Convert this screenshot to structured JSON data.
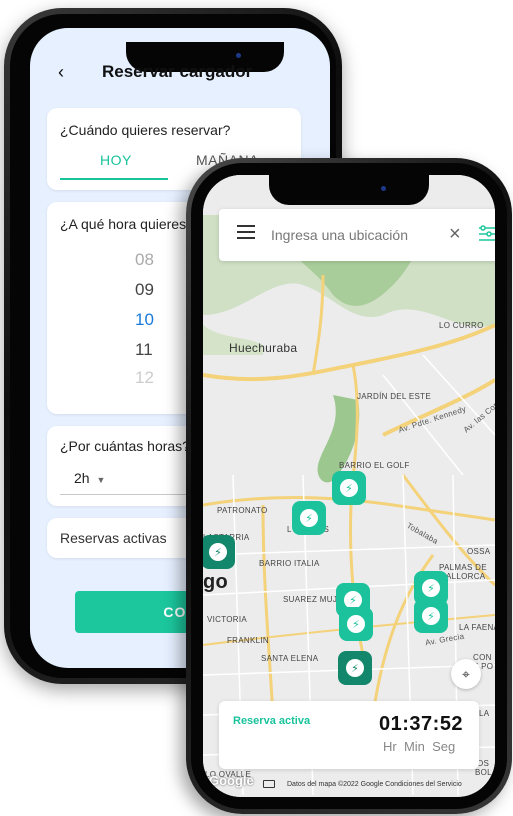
{
  "booking": {
    "title": "Reservar cargador",
    "when_question": "¿Cuándo quieres reservar?",
    "tabs": [
      {
        "label": "HOY"
      },
      {
        "label": "MAÑANA"
      }
    ],
    "hour_question": "¿A qué hora quieres",
    "hours": [
      "08",
      "09",
      "10",
      "11",
      "12"
    ],
    "selected_hour": "10",
    "duration_question": "¿Por cuántas horas?",
    "duration_value": "2h",
    "active_reservations": "Reservas activas",
    "cta_label": "CONTIN"
  },
  "map": {
    "search_placeholder": "Ingresa una ubicación",
    "labels": {
      "huechuraba": "Huechuraba",
      "lo_curro": "LO CURRO",
      "jardin": "JARDÍN DEL ESTE",
      "av_kennedy": "Av. Pdte. Kennedy",
      "av_condes": "Av. las Cond",
      "barrio_golf": "BARRIO EL GOLF",
      "patronato": "PATRONATO",
      "lastarria": "LASTARRIA",
      "bosques": "L   ANQUES",
      "tobalaba": "Tobalaba",
      "barrio_italia": "BARRIO ITALIA",
      "ossa": "OSSA",
      "palmas": "PALMAS DE",
      "mallorca": "MALLORCA",
      "go": "go",
      "suarez": "SUAREZ MUJ",
      "victoria": "VICTORIA",
      "la_faena": "LA FAENA",
      "av_grecia": "Av. Grecia",
      "franklin": "FRANKLIN",
      "santa_elena": "SANTA ELENA",
      "con": "CON",
      "e_po": "E PO",
      "la": "LA",
      "lo_ovalle": "LO OVALLE",
      "os": "OS",
      "bol": "BOL"
    },
    "active_reservation_label": "Reserva activa",
    "timer": "01:37:52",
    "timer_units": "Hr  Min  Seg",
    "google": "Google",
    "footer": "Datos del mapa ©2022 Google    Condiciones del Servicio"
  },
  "colors": {
    "accent": "#1cc79d",
    "selected_hour": "#1a7ad9",
    "back_screen_bg": "#e6f0ff"
  }
}
